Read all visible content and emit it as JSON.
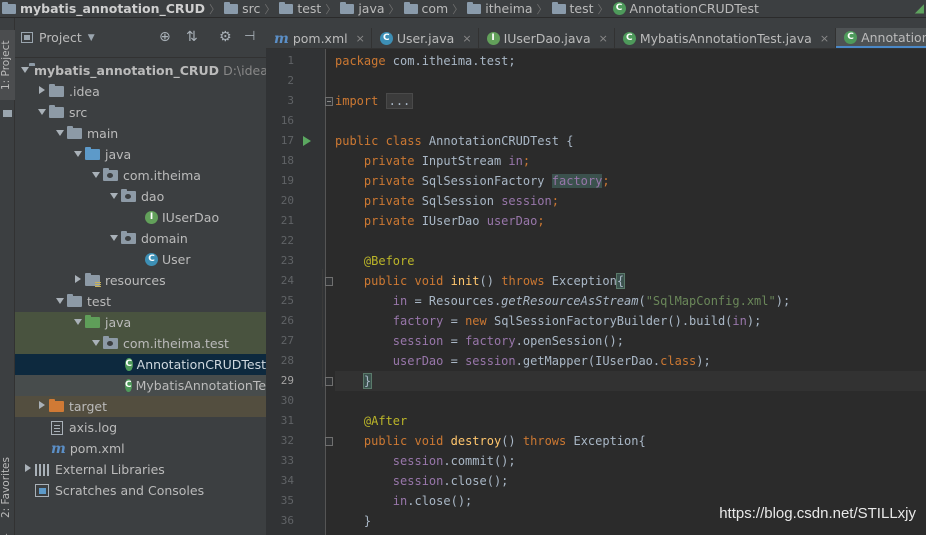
{
  "breadcrumb": {
    "items": [
      "mybatis_annotation_CRUD",
      "src",
      "test",
      "java",
      "com",
      "itheima",
      "test",
      "AnnotationCRUDTest"
    ]
  },
  "left_strip": {
    "project_tab": "1: Project",
    "favorites_tab": "2: Favorites"
  },
  "project_panel": {
    "title": "Project",
    "tree": [
      {
        "label": "mybatis_annotation_CRUD",
        "hint": "D:\\idea_",
        "icon": "folder-icon"
      },
      {
        "label": ".idea",
        "icon": "folder-icon"
      },
      {
        "label": "src",
        "icon": "folder-icon"
      },
      {
        "label": "main",
        "icon": "folder-icon"
      },
      {
        "label": "java",
        "icon": "source-folder-icon"
      },
      {
        "label": "com.itheima",
        "icon": "package-icon"
      },
      {
        "label": "dao",
        "icon": "package-icon"
      },
      {
        "label": "IUserDao",
        "icon": "interface-icon"
      },
      {
        "label": "domain",
        "icon": "package-icon"
      },
      {
        "label": "User",
        "icon": "class-icon"
      },
      {
        "label": "resources",
        "icon": "resources-folder-icon"
      },
      {
        "label": "test",
        "icon": "folder-icon"
      },
      {
        "label": "java",
        "icon": "test-source-folder-icon"
      },
      {
        "label": "com.itheima.test",
        "icon": "package-icon"
      },
      {
        "label": "AnnotationCRUDTest",
        "icon": "test-class-icon"
      },
      {
        "label": "MybatisAnnotationTe",
        "icon": "test-class-icon"
      },
      {
        "label": "target",
        "icon": "excluded-folder-icon"
      },
      {
        "label": "axis.log",
        "icon": "file-icon"
      },
      {
        "label": "pom.xml",
        "icon": "maven-icon"
      },
      {
        "label": "External Libraries",
        "icon": "library-icon"
      },
      {
        "label": "Scratches and Consoles",
        "icon": "scratches-icon"
      }
    ]
  },
  "tabs": [
    {
      "label": "pom.xml",
      "icon": "maven-icon"
    },
    {
      "label": "User.java",
      "icon": "class-icon"
    },
    {
      "label": "IUserDao.java",
      "icon": "interface-icon"
    },
    {
      "label": "MybatisAnnotationTest.java",
      "icon": "test-class-icon"
    },
    {
      "label": "AnnotationCRUDTest",
      "icon": "test-class-icon"
    }
  ],
  "editor": {
    "line_numbers": [
      "1",
      "2",
      "3",
      "16",
      "17",
      "18",
      "19",
      "20",
      "21",
      "22",
      "23",
      "24",
      "25",
      "26",
      "27",
      "28",
      "29",
      "30",
      "31",
      "32",
      "33",
      "34",
      "35",
      "36"
    ],
    "code": {
      "l1_a": "package",
      "l1_b": " com.itheima.test;",
      "l3_a": "import",
      "l3_b": "...",
      "l17_a": "public class",
      "l17_b": " AnnotationCRUDTest {",
      "l18_a": "private",
      "l18_b": " InputStream ",
      "l18_c": "in",
      "l18_d": ";",
      "l19_a": "private",
      "l19_b": " SqlSessionFactory ",
      "l19_c": "factory",
      "l19_d": ";",
      "l20_a": "private",
      "l20_b": " SqlSession ",
      "l20_c": "session",
      "l20_d": ";",
      "l21_a": "private",
      "l21_b": " IUserDao ",
      "l21_c": "userDao",
      "l21_d": ";",
      "l23_a": "@Before",
      "l24_a": "public void",
      "l24_b": "init",
      "l24_c": "() ",
      "l24_d": "throws",
      "l24_e": " Exception",
      "l24_f": "{",
      "l25_a": "in",
      "l25_b": " = Resources.",
      "l25_c": "getResourceAsStream",
      "l25_d": "(",
      "l25_e": "\"SqlMapConfig.xml\"",
      "l25_f": ");",
      "l26_a": "factory",
      "l26_b": " = ",
      "l26_c": "new",
      "l26_d": " SqlSessionFactoryBuilder().build(",
      "l26_e": "in",
      "l26_f": ");",
      "l27_a": "session",
      "l27_b": " = ",
      "l27_c": "factory",
      "l27_d": ".openSession();",
      "l28_a": "userDao",
      "l28_b": " = ",
      "l28_c": "session",
      "l28_d": ".getMapper(IUserDao.",
      "l28_e": "class",
      "l28_f": ");",
      "l29_a": "}",
      "l31_a": "@After",
      "l32_a": "public void",
      "l32_b": "destroy",
      "l32_c": "() ",
      "l32_d": "throws",
      "l32_e": " Exception{",
      "l33_a": "session",
      "l33_b": ".commit();",
      "l34_a": "session",
      "l34_b": ".close();",
      "l35_a": "in",
      "l35_b": ".close();",
      "l36_a": "}"
    }
  },
  "watermark": "https://blog.csdn.net/STILLxjy"
}
